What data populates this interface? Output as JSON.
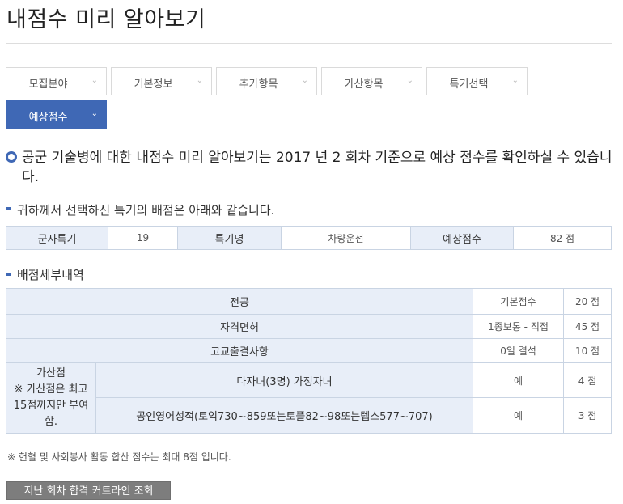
{
  "page": {
    "title": "내점수 미리 알아보기"
  },
  "steps": [
    {
      "label": "모집분야",
      "active": false
    },
    {
      "label": "기본정보",
      "active": false
    },
    {
      "label": "추가항목",
      "active": false
    },
    {
      "label": "가산항목",
      "active": false
    },
    {
      "label": "특기선택",
      "active": false
    },
    {
      "label": "예상점수",
      "active": true
    }
  ],
  "info": {
    "text": "공군 기술병에 대한 내점수 미리 알아보기는 2017 년 2 회차 기준으로 예상 점수를 확인하실 수 있습니다."
  },
  "summary": {
    "title": "귀하께서 선택하신 특기의 배점은 아래와 같습니다.",
    "h1": "군사특기",
    "v1": "19",
    "h2": "특기명",
    "v2": "차량운전",
    "h3": "예상점수",
    "v3": "82 점"
  },
  "detail": {
    "title": "배점세부내역",
    "rows": [
      {
        "label": "전공",
        "col3": "기본점수",
        "score": "20 점"
      },
      {
        "label": "자격면허",
        "col3": "1종보통 - 직접",
        "score": "45 점"
      },
      {
        "label": "고교출결사항",
        "col3": "0일 결석",
        "score": "10 점"
      }
    ],
    "bonus": {
      "header": "가산점\n※ 가산점은 최고 15점까지만 부여함.",
      "rows": [
        {
          "label": "다자녀(3명) 가정자녀",
          "col3": "예",
          "score": "4 점"
        },
        {
          "label": "공인영어성적(토익730~859또는토플82~98또는텝스577~707)",
          "col3": "예",
          "score": "3 점"
        }
      ]
    }
  },
  "note": "※ 헌혈 및 사회봉사 활동 합산 점수는 최대 8점 입니다.",
  "history_button": "지난 회차 합격 커트라인 조회",
  "colors": {
    "accent": "#3f68b5",
    "header_bg": "#e8eef8",
    "border": "#c9d4e3",
    "button_bg": "#7d7d7d"
  }
}
